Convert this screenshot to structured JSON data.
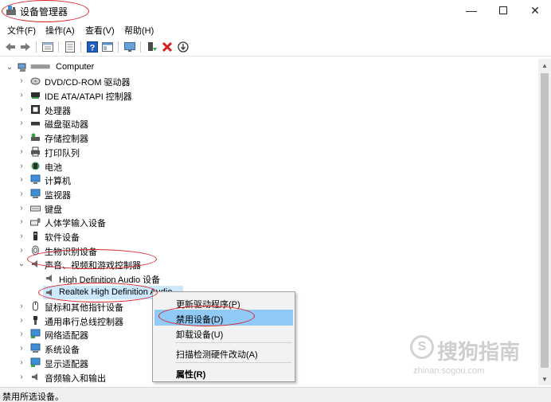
{
  "window": {
    "title": "设备管理器",
    "controls": {
      "minimize": "—",
      "maximize": "",
      "close": "✕"
    }
  },
  "menu": [
    "文件(F)",
    "操作(A)",
    "查看(V)",
    "帮助(H)"
  ],
  "toolbar": [
    "back-icon",
    "forward-icon",
    "properties-grid-icon",
    "show-hidden-icon",
    "help-icon",
    "view-icon",
    "monitor-icon",
    "update-driver-icon",
    "uninstall-icon",
    "scan-icon"
  ],
  "tree": {
    "root": "Computer",
    "root_prefix_redacted": "■■■■■",
    "categories": [
      "DVD/CD-ROM 驱动器",
      "IDE ATA/ATAPI 控制器",
      "处理器",
      "磁盘驱动器",
      "存储控制器",
      "打印队列",
      "电池",
      "计算机",
      "监视器",
      "键盘",
      "人体学输入设备",
      "软件设备",
      "生物识别设备",
      "声音、视频和游戏控制器"
    ],
    "expanded_children": [
      "High Definition Audio 设备",
      "Realtek High Definition Audio"
    ],
    "after": [
      "鼠标和其他指针设备",
      "通用串行总线控制器",
      "网络适配器",
      "系统设备",
      "显示适配器",
      "音频输入和输出"
    ]
  },
  "context_menu": {
    "items": [
      "更新驱动程序(P)",
      "禁用设备(D)",
      "卸载设备(U)",
      "扫描检测硬件改动(A)",
      "属性(R)"
    ],
    "highlighted": "禁用设备(D)"
  },
  "status": "禁用所选设备。",
  "watermark": {
    "logo": "S",
    "text": "搜狗指南",
    "url": "zhinan.sogou.com"
  },
  "colors": {
    "annotation": "#d8232a",
    "highlight": "#91c9f7",
    "uninstall": "#d81e1e"
  }
}
